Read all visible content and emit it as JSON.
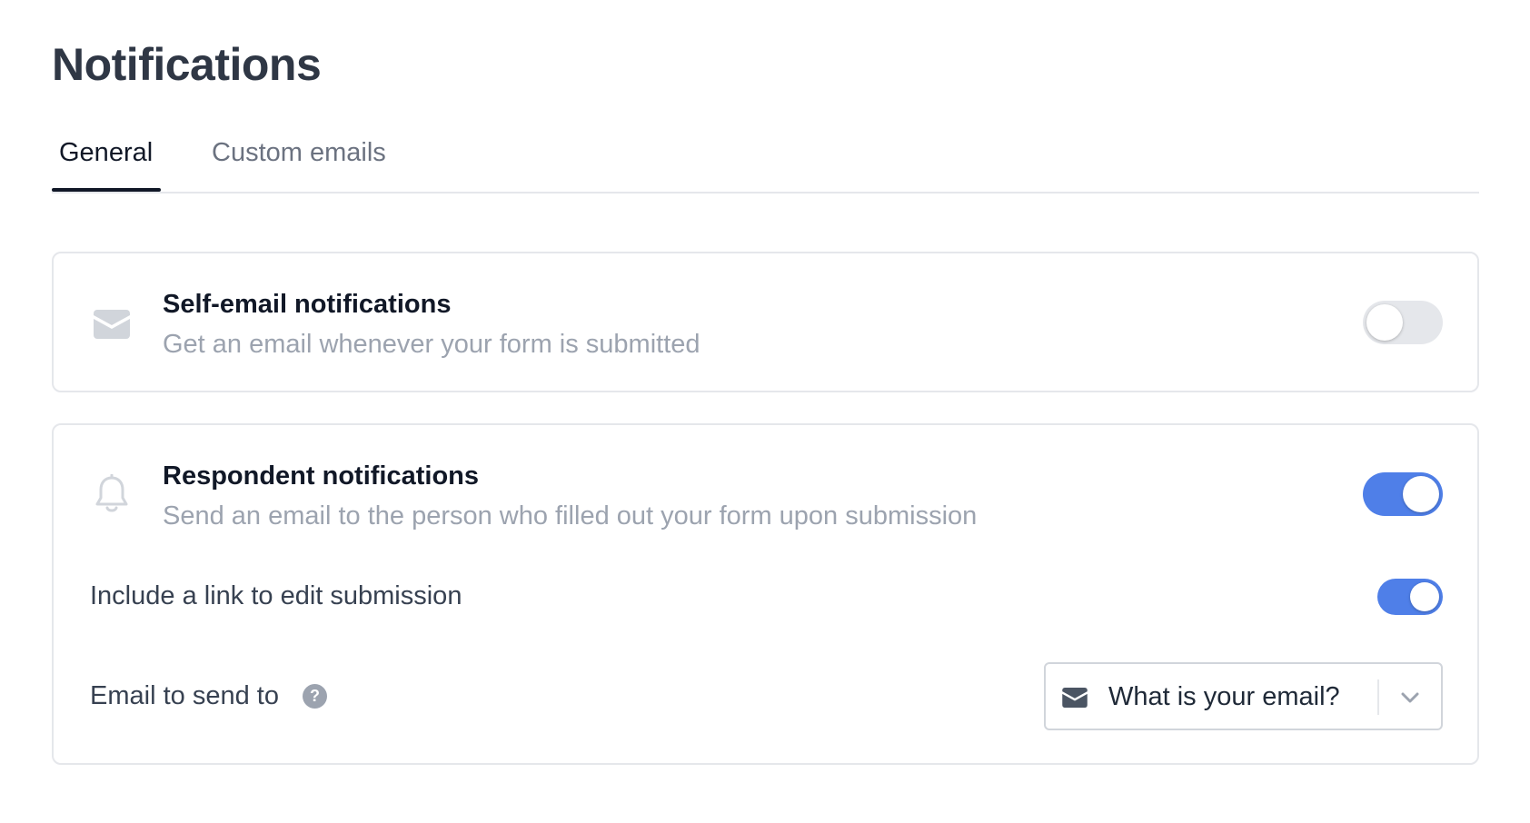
{
  "page": {
    "title": "Notifications"
  },
  "tabs": [
    {
      "label": "General",
      "active": true
    },
    {
      "label": "Custom emails",
      "active": false
    }
  ],
  "self_email": {
    "title": "Self-email notifications",
    "description": "Get an email whenever your form is submitted",
    "enabled": false,
    "icon": "envelope-icon"
  },
  "respondent": {
    "title": "Respondent notifications",
    "description": "Send an email to the person who filled out your form upon submission",
    "enabled": true,
    "icon": "bell-icon",
    "include_edit_link": {
      "label": "Include a link to edit submission",
      "enabled": true
    },
    "email_to": {
      "label": "Email to send to",
      "help_glyph": "?",
      "selected_value": "What is your email?",
      "value_icon": "envelope-icon"
    }
  },
  "colors": {
    "accent": "#4f7fe8",
    "toggle_off": "#e5e7eb",
    "title": "#2f3745",
    "muted": "#9ca3af"
  }
}
